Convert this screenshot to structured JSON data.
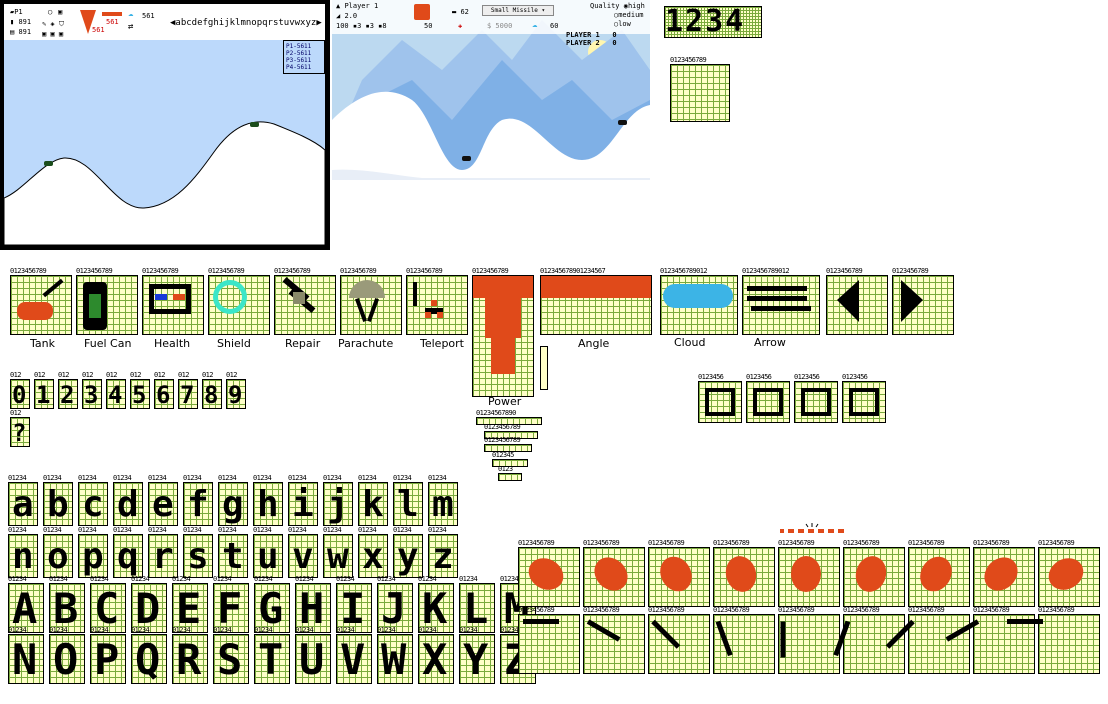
{
  "preview_left": {
    "hud": {
      "player": "P1",
      "fuel": "891",
      "units": "891",
      "power": "561",
      "angle": "561",
      "wind": "561",
      "alphabet": "abcdefghijklmnopqrstuvwxyz"
    },
    "scoreboard": [
      "P1-5611",
      "P2-5611",
      "P3-5611",
      "P4-5611"
    ]
  },
  "preview_right": {
    "player_label": "Player 1",
    "angle_value": "2.0",
    "power_value": "50",
    "fuel_value": "62",
    "money": "$ 5000",
    "wind_value": "60",
    "mode": "Small Missile",
    "quality_label": "Quality",
    "quality_options": [
      "high",
      "medium",
      "low"
    ],
    "counters": [
      "100",
      "3",
      "3",
      "8"
    ],
    "scores": [
      {
        "name": "PLAYER 1",
        "value": "0"
      },
      {
        "name": "PLAYER 2",
        "value": "0"
      }
    ]
  },
  "big_digits": "1234",
  "grid_headers": {
    "ten": "0123456789",
    "thirteen": "0123456789012",
    "eighteen": "012345678901234567",
    "eleven": "01234567890",
    "three": "012",
    "five": "01234",
    "seven": "0123456",
    "six": "012345",
    "four": "0123"
  },
  "sprite_labels": [
    "Tank",
    "Fuel Can",
    "Health",
    "Shield",
    "Repair",
    "Parachute",
    "Teleport",
    "Power",
    "Angle",
    "Cloud",
    "Arrow"
  ],
  "colors": {
    "grid_bg": "#ffffc8",
    "grid_line": "#7aaa3c",
    "sprite_red": "#e04a1a",
    "sky": "#bcd9fb",
    "cloud": "#3cb4e6"
  }
}
